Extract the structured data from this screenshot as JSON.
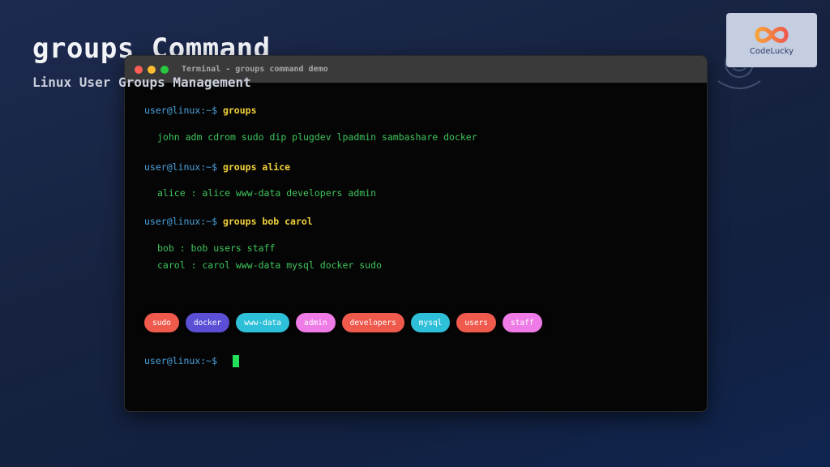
{
  "slide": {
    "title": "groups Command",
    "subtitle": "Linux User Groups Management"
  },
  "logo": {
    "text": "CodeLucky"
  },
  "terminal": {
    "title": "Terminal - groups command demo",
    "prompt": "user@linux:~$",
    "commands": [
      {
        "cmd": "groups",
        "output": [
          "john adm cdrom sudo dip plugdev lpadmin sambashare docker"
        ]
      },
      {
        "cmd": "groups alice",
        "output": [
          "alice : alice www-data developers admin"
        ]
      },
      {
        "cmd": "groups bob carol",
        "output": [
          "bob : bob users staff",
          "carol : carol www-data mysql docker sudo"
        ]
      }
    ],
    "badges": [
      {
        "label": "sudo",
        "color": "#ef5a4c"
      },
      {
        "label": "docker",
        "color": "#5b4fd6"
      },
      {
        "label": "www-data",
        "color": "#2ec0d8"
      },
      {
        "label": "admin",
        "color": "#ee7be6"
      },
      {
        "label": "developers",
        "color": "#ef5a4c"
      },
      {
        "label": "mysql",
        "color": "#2ec0d8"
      },
      {
        "label": "users",
        "color": "#ef5a4c"
      },
      {
        "label": "staff",
        "color": "#ee7be6"
      }
    ]
  }
}
